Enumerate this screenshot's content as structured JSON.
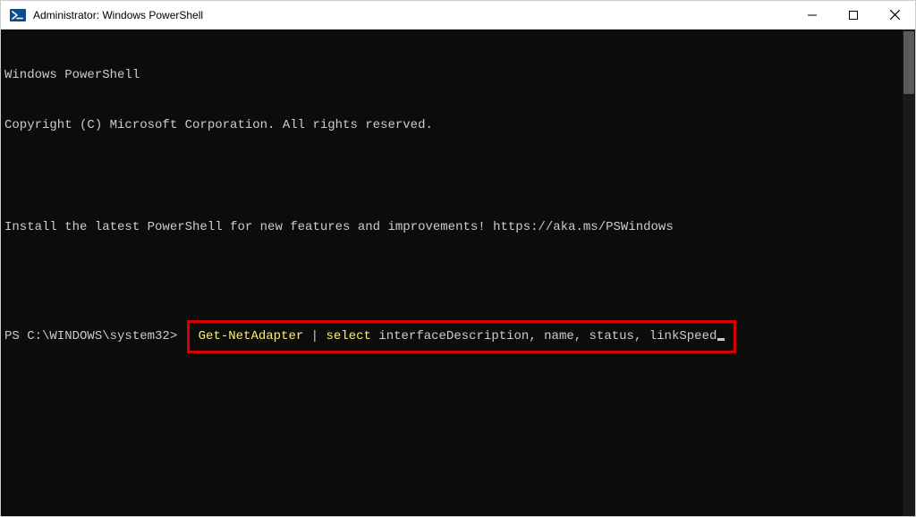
{
  "window": {
    "title": "Administrator: Windows PowerShell"
  },
  "terminal": {
    "header_line1": "Windows PowerShell",
    "header_line2": "Copyright (C) Microsoft Corporation. All rights reserved.",
    "install_line": "Install the latest PowerShell for new features and improvements! https://aka.ms/PSWindows",
    "prompt": "PS C:\\WINDOWS\\system32>",
    "command": {
      "cmdlet": "Get-NetAdapter",
      "pipe": " | ",
      "select": "select",
      "args": " interfaceDescription, name, status, linkSpeed"
    }
  }
}
